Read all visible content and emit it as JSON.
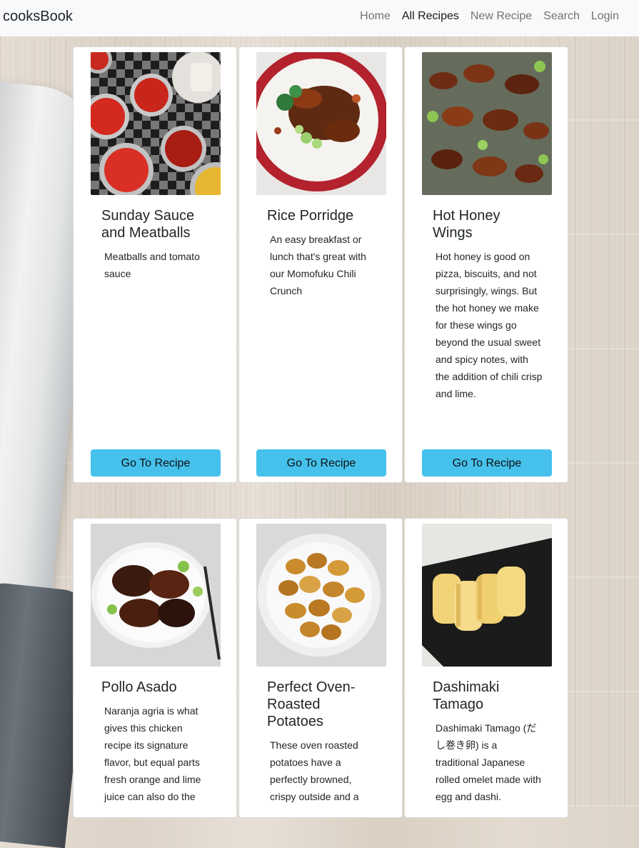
{
  "navbar": {
    "brand": "cooksBook",
    "links": [
      "Home",
      "All Recipes",
      "New Recipe",
      "Search",
      "Login"
    ],
    "active": "All Recipes"
  },
  "recipes": [
    {
      "title": "Sunday Sauce and Meatballs",
      "description": "Meatballs and tomato sauce",
      "button": "Go To Recipe"
    },
    {
      "title": "Rice Porridge",
      "description": "An easy breakfast or lunch that's great with our Momofuku Chili Crunch",
      "button": "Go To Recipe"
    },
    {
      "title": "Hot Honey Wings",
      "description": "Hot honey is good on pizza, biscuits, and not surprisingly, wings. But the hot honey we make for these wings go beyond the usual sweet and spicy notes, with the addition of chili crisp and lime.",
      "button": "Go To Recipe"
    },
    {
      "title": "Pollo Asado",
      "description": "Naranja agria is what gives this chicken recipe its signature flavor, but equal parts fresh orange and lime juice can also do the"
    },
    {
      "title": "Perfect Oven-Roasted Potatoes",
      "description": "These oven roasted potatoes have a perfectly browned, crispy outside and a"
    },
    {
      "title": "Dashimaki Tamago",
      "description": "Dashimaki Tamago (だし巻き卵) is a traditional Japanese rolled omelet made with egg and dashi."
    }
  ],
  "colors": {
    "button": "#45c1ec",
    "navbar_bg": "#f8f9fa"
  }
}
